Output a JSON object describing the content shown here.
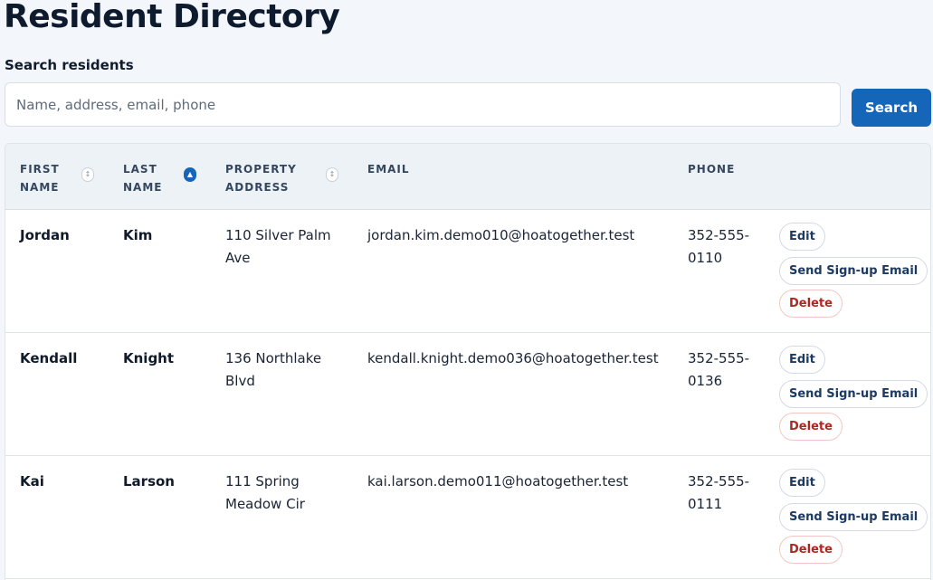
{
  "page": {
    "title": "Resident Directory"
  },
  "search": {
    "label": "Search residents",
    "placeholder": "Name, address, email, phone",
    "value": "",
    "button_label": "Search"
  },
  "table": {
    "columns": {
      "first_name": [
        "First",
        "Name"
      ],
      "last_name": [
        "Last",
        "Name"
      ],
      "property_address": [
        "Property",
        "Address"
      ],
      "email": [
        "Email"
      ],
      "phone": [
        "Phone"
      ]
    },
    "sort": {
      "column": "last_name",
      "direction": "ascending",
      "active_icon": "sort-ascending-icon",
      "inactive_icon": "sort-neutral-icon"
    },
    "action_labels": {
      "edit": "Edit",
      "send_signup": "Send Sign-up Email",
      "delete": "Delete"
    },
    "rows": [
      {
        "first_name": "Jordan",
        "last_name": "Kim",
        "address_line1": "110 Silver Palm",
        "address_line2": "Ave",
        "email": "jordan.kim.demo010@hoatogether.test",
        "phone_line1": "352-555-",
        "phone_line2": "0110"
      },
      {
        "first_name": "Kendall",
        "last_name": "Knight",
        "address_line1": "136 Northlake",
        "address_line2": "Blvd",
        "email": "kendall.knight.demo036@hoatogether.test",
        "phone_line1": "352-555-",
        "phone_line2": "0136"
      },
      {
        "first_name": "Kai",
        "last_name": "Larson",
        "address_line1": "111 Spring",
        "address_line2": "Meadow Cir",
        "email": "kai.larson.demo011@hoatogether.test",
        "phone_line1": "352-555-",
        "phone_line2": "0111"
      }
    ]
  },
  "colors": {
    "primary": "#1565b8",
    "danger": "#b1271f",
    "background": "#f3f6fa",
    "header_background": "#edf2f7"
  }
}
